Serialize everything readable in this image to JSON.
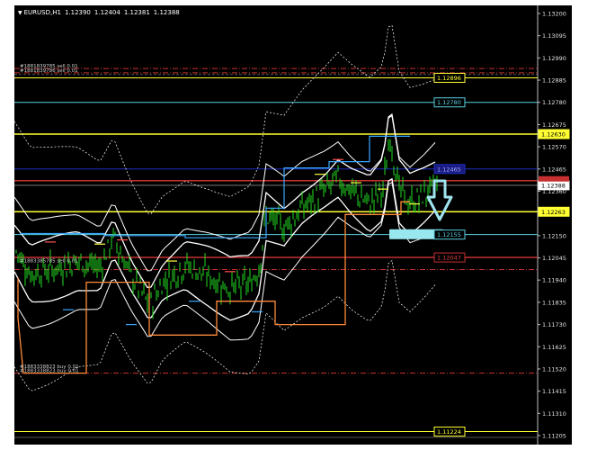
{
  "window": {
    "symbol_timeframe": "EURUSD,H1",
    "ohlc": [
      "1.12390",
      "1.12404",
      "1.12381",
      "1.12388"
    ]
  },
  "colors": {
    "background": "#000000",
    "candles": "#22dd22",
    "bands": "#ffffff",
    "envelope_ma": "#d8d8a0",
    "orange_channel": "#ff8a3a",
    "cyan_channel": "#3aa8ff",
    "resistance": "#ffff33",
    "support_zone": "#99e8f0",
    "order_line": "#c63030",
    "current_price": "#ffffff",
    "arrow": "#9fe4ee"
  },
  "price_axis": {
    "ticks": [
      "1.13200",
      "1.13095",
      "1.12990",
      "1.12885",
      "1.12780",
      "1.12675",
      "1.12570",
      "1.12465",
      "1.12360",
      "1.12255",
      "1.12150",
      "1.12045",
      "1.11940",
      "1.11835",
      "1.11730",
      "1.11625",
      "1.11520",
      "1.11415",
      "1.11310",
      "1.11205"
    ],
    "labels": [
      {
        "text": "1.12896",
        "kind": "yellow-line",
        "price": 1.12896
      },
      {
        "text": "1.12780",
        "kind": "cyan-line",
        "price": 1.1278
      },
      {
        "text": "1.12630",
        "kind": "yellow-line-filled",
        "price": 1.1263
      },
      {
        "text": "1.12465",
        "kind": "blue-line",
        "price": 1.12465
      },
      {
        "text": "1.12388",
        "kind": "current-price",
        "price": 1.12388
      },
      {
        "text": "1.12263",
        "kind": "yellow-line-filled",
        "price": 1.12263
      },
      {
        "text": "1.12155",
        "kind": "cyan-line",
        "price": 1.12155
      },
      {
        "text": "1.12047",
        "kind": "red-line",
        "price": 1.12047
      },
      {
        "text": "1.11224",
        "kind": "yellow-line",
        "price": 1.11224
      }
    ]
  },
  "order_labels": [
    {
      "text": "#1881839785 sell 0.01",
      "price": 1.1294
    },
    {
      "text": "#1881839786 sell 0.01",
      "price": 1.1292
    },
    {
      "text": "#1883385785 sell 0.01",
      "price": 1.1202
    },
    {
      "text": "#1883338823 buy 0.01",
      "price": 1.1152
    },
    {
      "text": "#1883338823 buy 0.01",
      "price": 1.115
    }
  ]
}
